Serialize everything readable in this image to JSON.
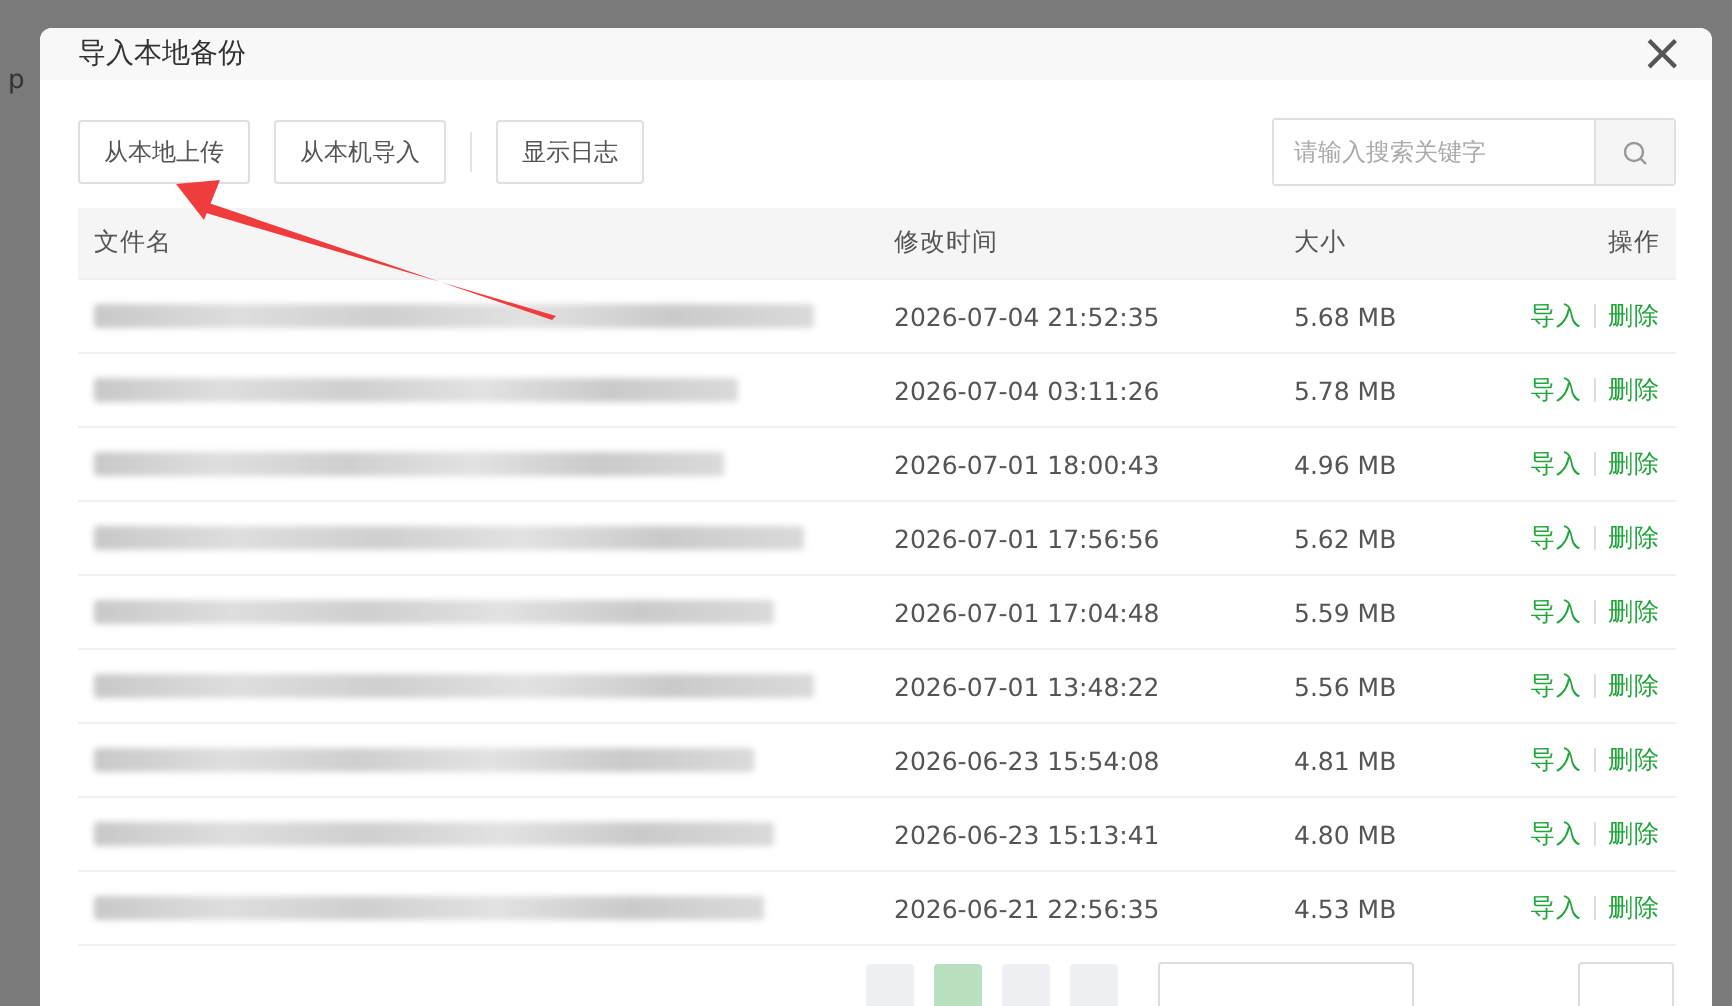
{
  "background": {
    "fragment": "p"
  },
  "dialog": {
    "title": "导入本地备份",
    "close": "×"
  },
  "toolbar": {
    "buttons": [
      {
        "label": "从本地上传",
        "kind": "button"
      },
      {
        "label": "从本机导入",
        "kind": "button"
      },
      {
        "kind": "divider"
      },
      {
        "label": "显示日志",
        "kind": "button"
      }
    ],
    "search": {
      "placeholder": "请输入搜索关键字"
    }
  },
  "table": {
    "columns": [
      "文件名",
      "修改时间",
      "大小",
      "操作"
    ],
    "rows": [
      {
        "modified": "2026-07-04 21:52:35",
        "size": "5.68 MB",
        "actions": [
          "导入",
          "删除"
        ]
      },
      {
        "modified": "2026-07-04 03:11:26",
        "size": "5.78 MB",
        "actions": [
          "导入",
          "删除"
        ]
      },
      {
        "modified": "2026-07-01 18:00:43",
        "size": "4.96 MB",
        "actions": [
          "导入",
          "删除"
        ]
      },
      {
        "modified": "2026-07-01 17:56:56",
        "size": "5.62 MB",
        "actions": [
          "导入",
          "删除"
        ]
      },
      {
        "modified": "2026-07-01 17:04:48",
        "size": "5.59 MB",
        "actions": [
          "导入",
          "删除"
        ]
      },
      {
        "modified": "2026-07-01 13:48:22",
        "size": "5.56 MB",
        "actions": [
          "导入",
          "删除"
        ]
      },
      {
        "modified": "2026-06-23 15:54:08",
        "size": "4.81 MB",
        "actions": [
          "导入",
          "删除"
        ]
      },
      {
        "modified": "2026-06-23 15:13:41",
        "size": "4.80 MB",
        "actions": [
          "导入",
          "删除"
        ]
      },
      {
        "modified": "2026-06-21 22:56:35",
        "size": "4.53 MB",
        "actions": [
          "导入",
          "删除"
        ]
      }
    ]
  },
  "pagination": {
    "pages": [
      {
        "selected": false
      },
      {
        "selected": true
      },
      {
        "selected": false
      },
      {
        "selected": false
      }
    ]
  }
}
